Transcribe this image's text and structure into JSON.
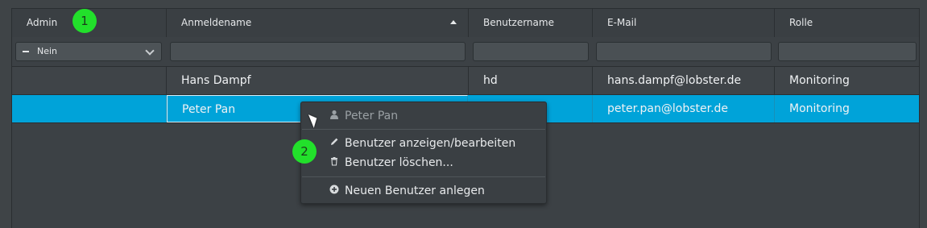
{
  "header": {
    "columns": [
      {
        "label": "Admin"
      },
      {
        "label": "Anmeldename"
      },
      {
        "label": "Benutzername"
      },
      {
        "label": "E-Mail"
      },
      {
        "label": "Rolle"
      }
    ]
  },
  "filter": {
    "admin_select_value": "Nein"
  },
  "rows": [
    {
      "admin": "",
      "login": "Hans Dampf",
      "username": "hd",
      "email": "hans.dampf@lobster.de",
      "role": "Monitoring"
    },
    {
      "admin": "",
      "login": "Peter Pan",
      "username": "",
      "email": "peter.pan@lobster.de",
      "role": "Monitoring"
    }
  ],
  "context_menu": {
    "title": "Peter Pan",
    "items": [
      {
        "label": "Benutzer anzeigen/bearbeiten",
        "icon": "pencil-icon"
      },
      {
        "label": "Benutzer löschen...",
        "icon": "trash-icon"
      },
      {
        "label": "Neuen Benutzer anlegen",
        "icon": "plus-circle-icon"
      }
    ]
  },
  "badges": {
    "one": "1",
    "two": "2"
  },
  "colors": {
    "selected_row": "#00a3d9",
    "badge": "#22e02b",
    "background": "#3f4447"
  }
}
